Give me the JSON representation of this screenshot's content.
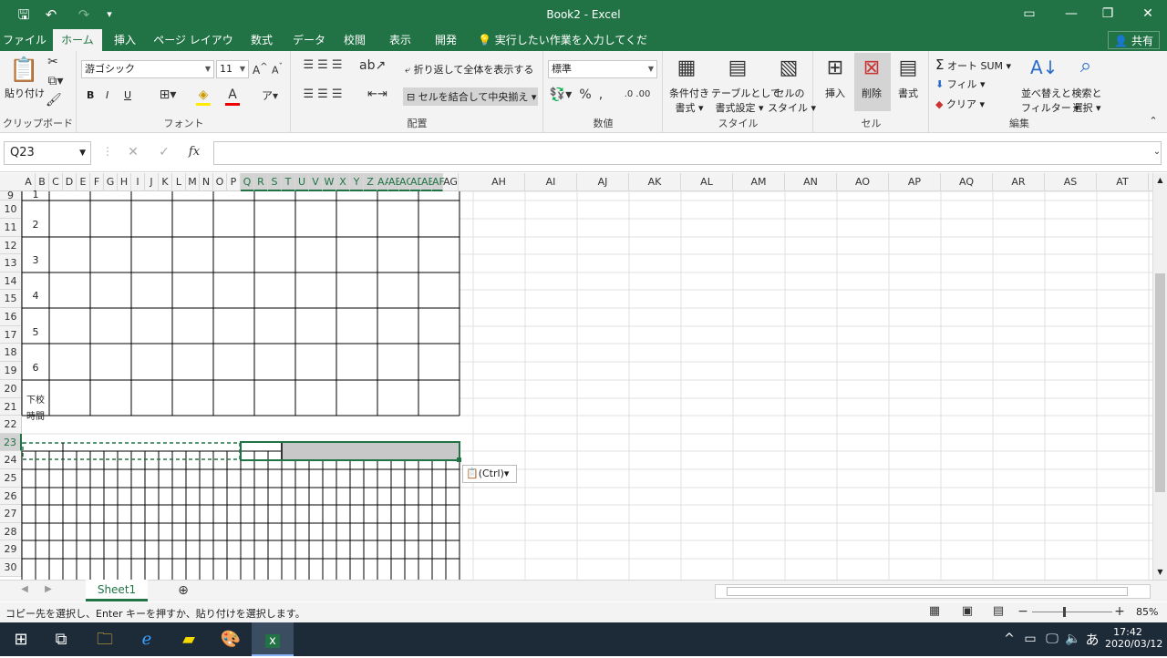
{
  "titlebar": {
    "title": "Book2 - Excel"
  },
  "tabs": [
    "ファイル",
    "ホーム",
    "挿入",
    "ページ レイアウト",
    "数式",
    "データ",
    "校閲",
    "表示",
    "開発"
  ],
  "tellme": "実行したい作業を入力してください...",
  "share": "共有",
  "ribbon": {
    "clipboard": {
      "paste": "貼り付け",
      "label": "クリップボード"
    },
    "font": {
      "name": "游ゴシック",
      "size": "11",
      "bold": "B",
      "italic": "I",
      "underline": "U",
      "label": "フォント"
    },
    "alignment": {
      "wrap": "折り返して全体を表示する",
      "merge": "セルを結合して中央揃え",
      "label": "配置"
    },
    "number": {
      "format": "標準",
      "label": "数値"
    },
    "styles": {
      "cond": [
        "条件付き",
        "書式"
      ],
      "table": [
        "テーブルとして",
        "書式設定"
      ],
      "cell": [
        "セルの",
        "スタイル"
      ],
      "label": "スタイル"
    },
    "cells": {
      "insert": "挿入",
      "delete": "削除",
      "format": "書式",
      "label": "セル"
    },
    "editing": {
      "autosum": "オート SUM",
      "fill": "フィル",
      "clear": "クリア",
      "sort": [
        "並べ替えと",
        "フィルター"
      ],
      "find": [
        "検索と",
        "選択"
      ],
      "label": "編集"
    }
  },
  "formula": {
    "namebox": "Q23",
    "fx": "fx",
    "value": ""
  },
  "colheaders_small": [
    "A",
    "B",
    "C",
    "D",
    "E",
    "F",
    "G",
    "H",
    "I",
    "J",
    "K",
    "L",
    "M",
    "N",
    "O",
    "P",
    "Q",
    "R",
    "S",
    "T",
    "U",
    "V",
    "W",
    "X",
    "Y",
    "Z",
    "AA",
    "AB",
    "AC",
    "AD",
    "AE",
    "AF",
    "AG"
  ],
  "colheaders_big": [
    "AH",
    "AI",
    "AJ",
    "AK",
    "AL",
    "AM",
    "AN",
    "AO",
    "AP",
    "AQ",
    "AR",
    "AS",
    "AT"
  ],
  "rows": [
    "9",
    "10",
    "11",
    "12",
    "13",
    "14",
    "15",
    "16",
    "17",
    "18",
    "19",
    "20",
    "21",
    "22",
    "23",
    "24",
    "25",
    "26",
    "27",
    "28",
    "29",
    "30"
  ],
  "period_labels": [
    "1",
    "2",
    "3",
    "4",
    "5",
    "6"
  ],
  "last_label": [
    "下校",
    "時間"
  ],
  "paste_options": "(Ctrl)",
  "sheet": {
    "name": "Sheet1"
  },
  "status": {
    "text": "コピー先を選択し、Enter キーを押すか、貼り付けを選択します。",
    "zoom": "85%"
  },
  "taskbar": {
    "time": "17:42",
    "date": "2020/03/12",
    "ime": "あ"
  }
}
